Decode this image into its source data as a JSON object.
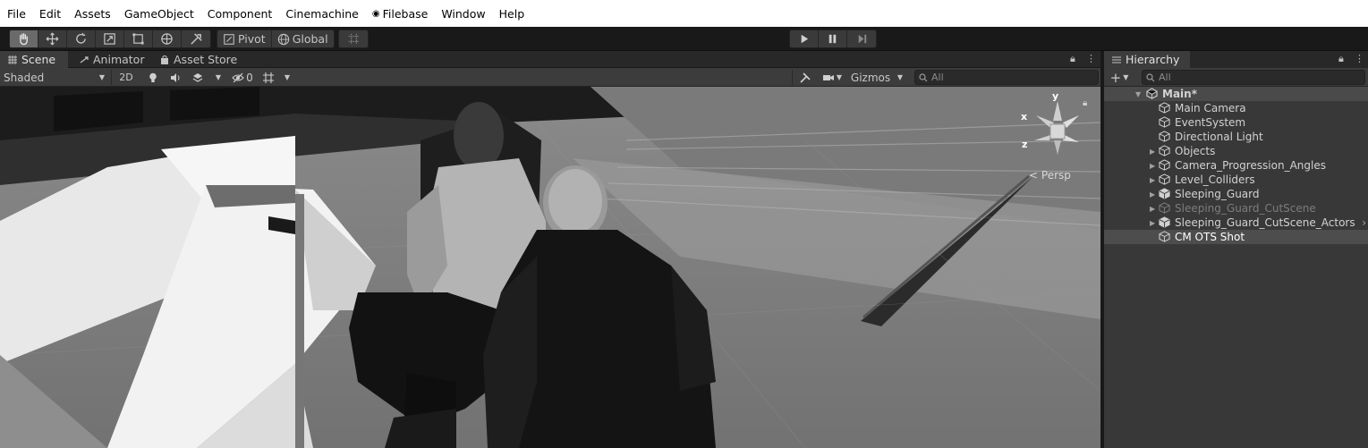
{
  "menu": [
    "File",
    "Edit",
    "Assets",
    "GameObject",
    "Component",
    "Cinemachine",
    "Filebase",
    "Window",
    "Help"
  ],
  "toolbar": {
    "tools": [
      {
        "name": "hand-tool",
        "icon": "hand-icon",
        "active": true
      },
      {
        "name": "move-tool",
        "icon": "move-icon"
      },
      {
        "name": "rotate-tool",
        "icon": "rotate-icon"
      },
      {
        "name": "scale-tool",
        "icon": "scale-icon"
      },
      {
        "name": "rect-tool",
        "icon": "rect-icon"
      },
      {
        "name": "transform-tool",
        "icon": "transform-icon"
      },
      {
        "name": "custom-tool",
        "icon": "tools-icon"
      }
    ],
    "pivot_label": "Pivot",
    "global_label": "Global",
    "play": {
      "play_icon": "play-icon",
      "pause_icon": "pause-icon",
      "step_icon": "step-icon"
    }
  },
  "scene_panel": {
    "tabs": [
      {
        "label": "Scene",
        "icon": "scene-icon",
        "active": true
      },
      {
        "label": "Animator",
        "icon": "animator-icon"
      },
      {
        "label": "Asset Store",
        "icon": "store-icon"
      }
    ],
    "shading_mode": "Shaded",
    "mode_2d": "2D",
    "hidden_count": "0",
    "gizmos_label": "Gizmos",
    "search_placeholder": "All",
    "projection": "Persp",
    "gizmo_axes": {
      "y": "y",
      "x": "x",
      "z": "z"
    }
  },
  "hierarchy": {
    "title": "Hierarchy",
    "search_placeholder": "All",
    "scene_name": "Main*",
    "items": [
      {
        "label": "Main Camera",
        "has_children": false,
        "dim": false,
        "prefab": false
      },
      {
        "label": "EventSystem",
        "has_children": false,
        "dim": false,
        "prefab": false
      },
      {
        "label": "Directional Light",
        "has_children": false,
        "dim": false,
        "prefab": false
      },
      {
        "label": "Objects",
        "has_children": true,
        "dim": false,
        "prefab": false
      },
      {
        "label": "Camera_Progression_Angles",
        "has_children": true,
        "dim": false,
        "prefab": false
      },
      {
        "label": "Level_Colliders",
        "has_children": true,
        "dim": false,
        "prefab": false
      },
      {
        "label": "Sleeping_Guard",
        "has_children": true,
        "dim": false,
        "prefab": true
      },
      {
        "label": "Sleeping_Guard_CutScene",
        "has_children": true,
        "dim": true,
        "prefab": false
      },
      {
        "label": "Sleeping_Guard_CutScene_Actors",
        "has_children": true,
        "dim": false,
        "prefab": true
      },
      {
        "label": "CM OTS Shot",
        "has_children": false,
        "dim": false,
        "prefab": false,
        "selected": true
      }
    ]
  },
  "colors": {
    "menu_bg": "#ffffff",
    "toolbar_bg": "#191919",
    "panel_bg": "#383838",
    "active_tab": "#3c3c3c",
    "selection": "#4d4d4d"
  }
}
